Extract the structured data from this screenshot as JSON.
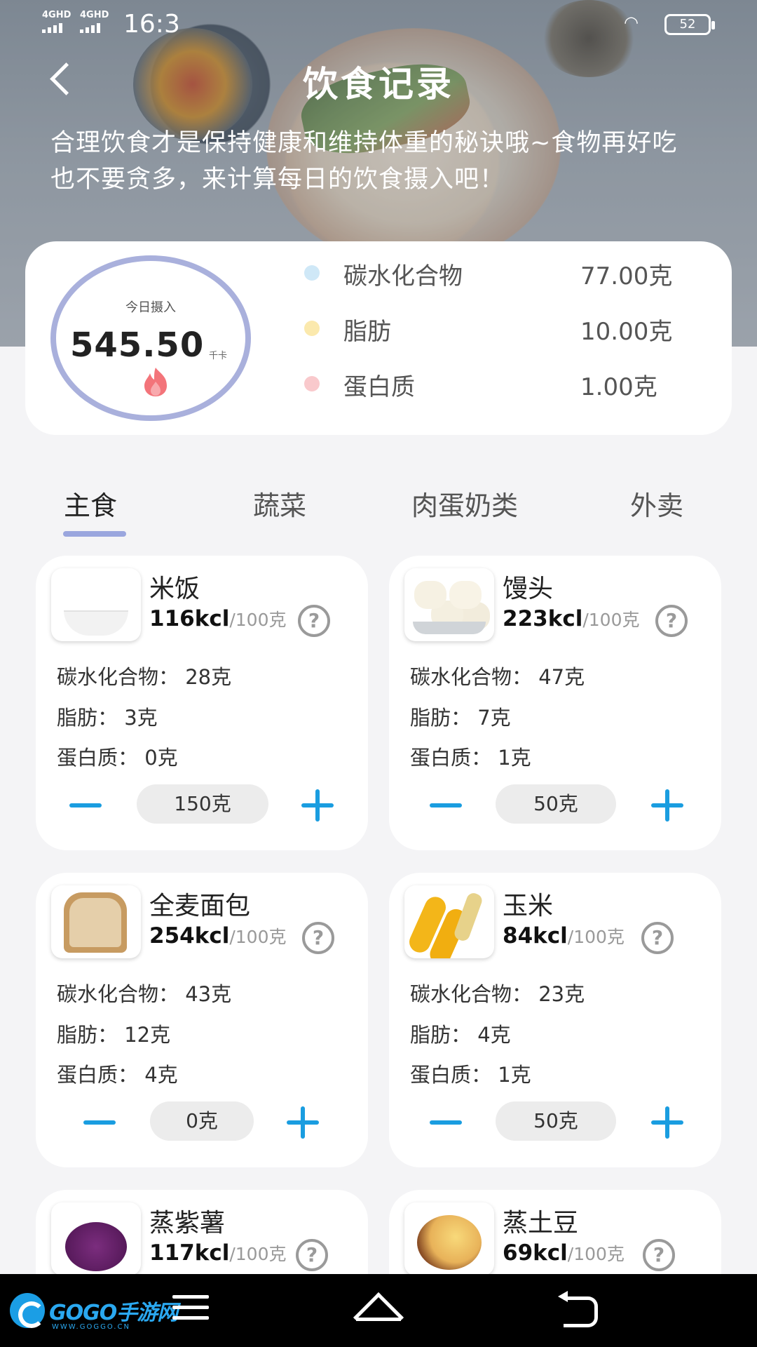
{
  "statusbar": {
    "network1": "4GHD",
    "network2": "4GHD",
    "time": "16:3",
    "battery": "52"
  },
  "header": {
    "title": "饮食记录",
    "subtitle": "合理饮食才是保持健康和维持体重的秘诀哦~食物再好吃也不要贪多，来计算每日的饮食摄入吧！"
  },
  "summary": {
    "intake_label": "今日摄入",
    "intake_value": "545.50",
    "intake_unit": "千卡",
    "macros": [
      {
        "name": "碳水化合物",
        "value": "77.00克",
        "color": "#cfe8f7"
      },
      {
        "name": "脂肪",
        "value": "10.00克",
        "color": "#fbe9ad"
      },
      {
        "name": "蛋白质",
        "value": "1.00克",
        "color": "#f9c9cc"
      }
    ],
    "ring_color": "#a9b0dc",
    "flame_color": "#f3747a"
  },
  "tabs": [
    {
      "label": "主食",
      "active": true
    },
    {
      "label": "蔬菜",
      "active": false
    },
    {
      "label": "肉蛋奶类",
      "active": false
    },
    {
      "label": "外卖",
      "active": false
    }
  ],
  "foods": [
    {
      "name": "米饭",
      "kcal": "116kcl",
      "per": "/100克",
      "carb": "碳水化合物：  28克",
      "fat": "脂肪：  3克",
      "protein": "蛋白质：  0克",
      "qty": "150克",
      "thumb": "rice-thumb"
    },
    {
      "name": "馒头",
      "kcal": "223kcl",
      "per": "/100克",
      "carb": "碳水化合物：  47克",
      "fat": "脂肪：  7克",
      "protein": "蛋白质：  1克",
      "qty": "50克",
      "thumb": "steamed-bun-thumb"
    },
    {
      "name": "全麦面包",
      "kcal": "254kcl",
      "per": "/100克",
      "carb": "碳水化合物：  43克",
      "fat": "脂肪：  12克",
      "protein": "蛋白质：  4克",
      "qty": "0克",
      "thumb": "bread-thumb"
    },
    {
      "name": "玉米",
      "kcal": "84kcl",
      "per": "/100克",
      "carb": "碳水化合物：  23克",
      "fat": "脂肪：  4克",
      "protein": "蛋白质：  1克",
      "qty": "50克",
      "thumb": "corn-thumb"
    },
    {
      "name": "蒸紫薯",
      "kcal": "117kcl",
      "per": "/100克",
      "thumb": "purple-yam-thumb"
    },
    {
      "name": "蒸土豆",
      "kcal": "69kcl",
      "per": "/100克",
      "thumb": "potato-thumb"
    }
  ],
  "help_glyph": "?",
  "accent_color": "#1a9de0",
  "navbar": {
    "logo_text": "GOGO手游网",
    "logo_sub": "WWW.GOGGO.CN"
  }
}
